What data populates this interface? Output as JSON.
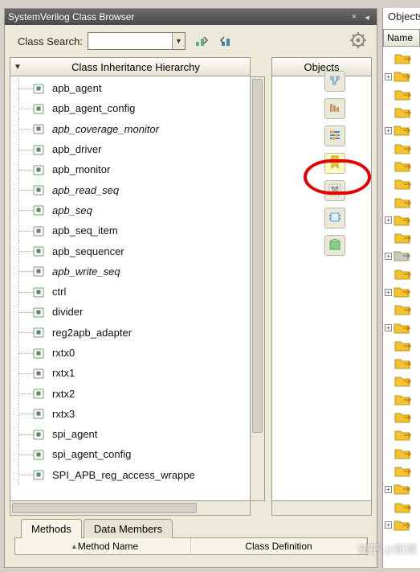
{
  "window": {
    "title": "SystemVerilog Class Browser",
    "close_glyph": "×",
    "pin_glyph": "◂"
  },
  "toolbar": {
    "search_label": "Class Search:",
    "search_value": ""
  },
  "tree": {
    "header": "Class Inheritance Hierarchy",
    "items": [
      {
        "label": "apb_agent",
        "italic": false
      },
      {
        "label": "apb_agent_config",
        "italic": false
      },
      {
        "label": "apb_coverage_monitor",
        "italic": true
      },
      {
        "label": "apb_driver",
        "italic": false
      },
      {
        "label": "apb_monitor",
        "italic": false
      },
      {
        "label": "apb_read_seq",
        "italic": true
      },
      {
        "label": "apb_seq",
        "italic": true
      },
      {
        "label": "apb_seq_item",
        "italic": false
      },
      {
        "label": "apb_sequencer",
        "italic": false
      },
      {
        "label": "apb_write_seq",
        "italic": true
      },
      {
        "label": "ctrl",
        "italic": false
      },
      {
        "label": "divider",
        "italic": false
      },
      {
        "label": "reg2apb_adapter",
        "italic": false
      },
      {
        "label": "rxtx0",
        "italic": false
      },
      {
        "label": "rxtx1",
        "italic": false
      },
      {
        "label": "rxtx2",
        "italic": false
      },
      {
        "label": "rxtx3",
        "italic": false
      },
      {
        "label": "spi_agent",
        "italic": false
      },
      {
        "label": "spi_agent_config",
        "italic": false
      },
      {
        "label": "SPI_APB_reg_access_wrappe",
        "italic": false
      }
    ]
  },
  "objects_col": {
    "header": "Objects"
  },
  "vtoolbar": {
    "items": [
      {
        "name": "view-topology-icon"
      },
      {
        "name": "view-hierarchy-icon"
      },
      {
        "name": "view-filter-icon"
      },
      {
        "name": "bookmark-icon",
        "selected": true
      },
      {
        "name": "view-graph-icon",
        "circled": true
      },
      {
        "name": "view-module-icon"
      },
      {
        "name": "view-package-icon"
      }
    ]
  },
  "tabs": {
    "active": "Methods",
    "items": [
      "Methods",
      "Data Members"
    ],
    "columns": [
      "Method Name",
      "Class Definition"
    ]
  },
  "right": {
    "title": "Objects",
    "col": "Name",
    "rows": [
      {
        "expand": "",
        "color": "yellow"
      },
      {
        "expand": "+",
        "color": "yellow"
      },
      {
        "expand": "",
        "color": "yellow"
      },
      {
        "expand": "",
        "color": "yellow"
      },
      {
        "expand": "+",
        "color": "yellow"
      },
      {
        "expand": "",
        "color": "yellow"
      },
      {
        "expand": "",
        "color": "yellow"
      },
      {
        "expand": "",
        "color": "yellow"
      },
      {
        "expand": "",
        "color": "yellow"
      },
      {
        "expand": "+",
        "color": "yellow"
      },
      {
        "expand": "",
        "color": "yellow"
      },
      {
        "expand": "+",
        "color": "grey"
      },
      {
        "expand": "",
        "color": "yellow"
      },
      {
        "expand": "+",
        "color": "yellow"
      },
      {
        "expand": "",
        "color": "yellow"
      },
      {
        "expand": "+",
        "color": "yellow"
      },
      {
        "expand": "",
        "color": "yellow"
      },
      {
        "expand": "",
        "color": "yellow"
      },
      {
        "expand": "",
        "color": "yellow"
      },
      {
        "expand": "",
        "color": "yellow"
      },
      {
        "expand": "",
        "color": "yellow"
      },
      {
        "expand": "",
        "color": "yellow"
      },
      {
        "expand": "",
        "color": "yellow"
      },
      {
        "expand": "",
        "color": "yellow"
      },
      {
        "expand": "+",
        "color": "yellow"
      },
      {
        "expand": "",
        "color": "yellow"
      },
      {
        "expand": "+",
        "color": "yellow"
      }
    ]
  },
  "watermark": "知乎 @新媒"
}
